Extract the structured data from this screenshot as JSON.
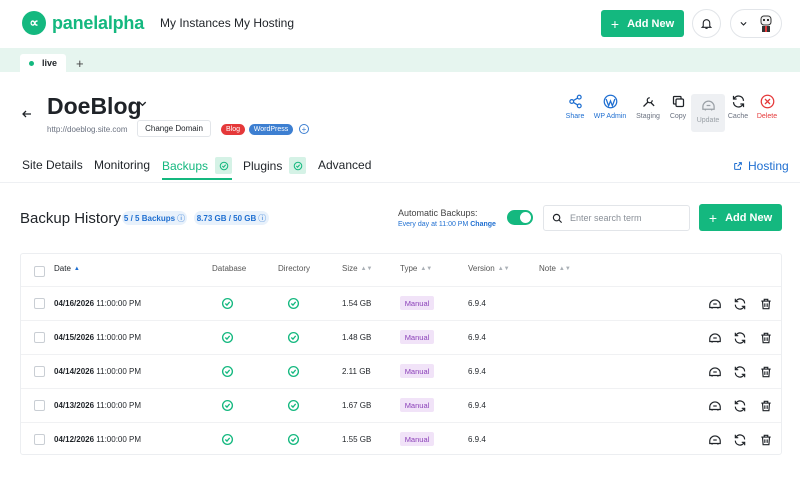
{
  "brand": {
    "name": "panelalpha",
    "accent": "#14b87f",
    "link": "#1f6fd1",
    "danger": "#e5393a"
  },
  "topnav": {
    "items": [
      "My Instances",
      "My Hosting"
    ],
    "add_new": "Add New",
    "bell_icon": "bell-icon"
  },
  "env_tabs": [
    {
      "label": "live"
    }
  ],
  "site": {
    "name": "DoeBlog",
    "url": "http://doeblog.site.com",
    "change_domain": "Change Domain",
    "tags": [
      "Blog",
      "WordPress"
    ]
  },
  "tools": [
    {
      "label": "Share",
      "icon": "share-icon",
      "state": "link"
    },
    {
      "label": "WP Admin",
      "icon": "wordpress-icon",
      "state": "link"
    },
    {
      "label": "Staging",
      "icon": "tools-icon",
      "state": "gray"
    },
    {
      "label": "Copy",
      "icon": "copy-icon",
      "state": "gray"
    },
    {
      "label": "Update",
      "icon": "update-icon",
      "state": "disabled"
    },
    {
      "label": "Cache",
      "icon": "refresh-icon",
      "state": "gray"
    },
    {
      "label": "Delete",
      "icon": "delete-icon",
      "state": "danger"
    }
  ],
  "subtabs": [
    {
      "label": "Site Details"
    },
    {
      "label": "Monitoring"
    },
    {
      "label": "Backups",
      "active": true,
      "check": true
    },
    {
      "label": "Plugins",
      "check": true
    },
    {
      "label": "Advanced"
    }
  ],
  "hosting_link": "Hosting",
  "backups": {
    "title": "Backup History",
    "count_pill": "5 / 5 Backups",
    "size_pill": "8.73 GB / 50 GB",
    "auto_label": "Automatic Backups:",
    "auto_schedule": "Every day at 11:00 PM",
    "auto_change": "Change",
    "auto_enabled": true,
    "search_placeholder": "Enter search term",
    "add_new": "Add New",
    "columns": [
      "Date",
      "Database",
      "Directory",
      "Size",
      "Type",
      "Version",
      "Note"
    ],
    "rows": [
      {
        "date": "04/16/2026",
        "time": "11:00:00 PM",
        "size": "1.54 GB",
        "type": "Manual",
        "version": "6.9.4",
        "note": ""
      },
      {
        "date": "04/15/2026",
        "time": "11:00:00 PM",
        "size": "1.48 GB",
        "type": "Manual",
        "version": "6.9.4",
        "note": ""
      },
      {
        "date": "04/14/2026",
        "time": "11:00:00 PM",
        "size": "2.11 GB",
        "type": "Manual",
        "version": "6.9.4",
        "note": ""
      },
      {
        "date": "04/13/2026",
        "time": "11:00:00 PM",
        "size": "1.67 GB",
        "type": "Manual",
        "version": "6.9.4",
        "note": ""
      },
      {
        "date": "04/12/2026",
        "time": "11:00:00 PM",
        "size": "1.55 GB",
        "type": "Manual",
        "version": "6.9.4",
        "note": ""
      }
    ]
  }
}
